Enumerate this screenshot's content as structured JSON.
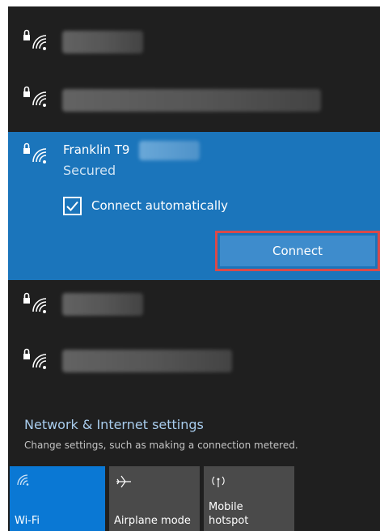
{
  "networks": [
    {
      "id": "net1",
      "name_visible": ""
    },
    {
      "id": "net2",
      "name_visible": ""
    }
  ],
  "selected_network": {
    "name": "Franklin T9",
    "status": "Secured",
    "connect_automatically": {
      "label": "Connect automatically",
      "checked": true
    },
    "connect_button_label": "Connect"
  },
  "network_settings": {
    "link": "Network & Internet settings",
    "description": "Change settings, such as making a connection metered."
  },
  "quick_actions": [
    {
      "label": "Wi-Fi",
      "active": true,
      "icon": "wifi-icon"
    },
    {
      "label": "Airplane mode",
      "active": false,
      "icon": "airplane-icon"
    },
    {
      "label": "Mobile hotspot",
      "active": false,
      "icon": "mobile-hotspot-icon"
    }
  ],
  "colors": {
    "panel_bg": "#1f1f1f",
    "selected_bg": "#1b75bb",
    "button_bg": "#3e8ccc",
    "highlight_border": "#d94a4a",
    "active_tile": "#0a78d4",
    "inactive_tile": "#4a4a4a",
    "link": "#a9cdee"
  }
}
